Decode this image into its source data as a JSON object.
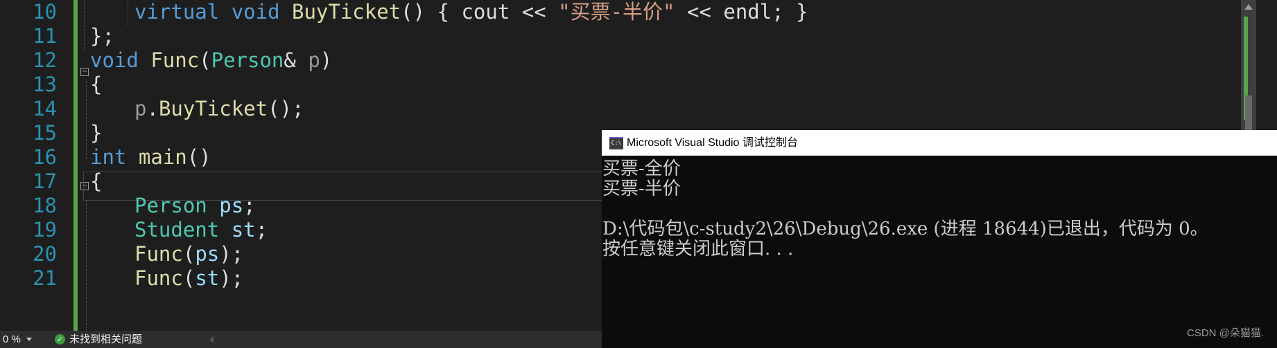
{
  "editor": {
    "line_numbers": [
      "10",
      "11",
      "12",
      "13",
      "14",
      "15",
      "16",
      "17",
      "18",
      "19",
      "20",
      "21"
    ],
    "lines": [
      {
        "segments": [
          [
            "kw",
            "virtual"
          ],
          [
            "",
            " "
          ],
          [
            "kw",
            "void"
          ],
          [
            "",
            " "
          ],
          [
            "fn",
            "BuyTicket"
          ],
          [
            "",
            "() { cout << "
          ],
          [
            "str",
            "\"买票-半价\""
          ],
          [
            "",
            " << endl; }"
          ]
        ]
      },
      {
        "segments": [
          [
            "",
            "};"
          ]
        ]
      },
      {
        "segments": [
          [
            "kw",
            "void"
          ],
          [
            "",
            " "
          ],
          [
            "fn",
            "Func"
          ],
          [
            "",
            "("
          ],
          [
            "ty",
            "Person"
          ],
          [
            "",
            "& "
          ],
          [
            "prm",
            "p"
          ],
          [
            "",
            ")"
          ]
        ]
      },
      {
        "segments": [
          [
            "",
            "{"
          ]
        ]
      },
      {
        "segments": [
          [
            "prm",
            "p"
          ],
          [
            "",
            "."
          ],
          [
            "fn",
            "BuyTicket"
          ],
          [
            "",
            "();"
          ]
        ]
      },
      {
        "segments": [
          [
            "",
            "}"
          ]
        ]
      },
      {
        "segments": [
          [
            "kw",
            "int"
          ],
          [
            "",
            " "
          ],
          [
            "fn",
            "main"
          ],
          [
            "",
            "()"
          ]
        ]
      },
      {
        "segments": [
          [
            "",
            "{"
          ]
        ]
      },
      {
        "segments": [
          [
            "ty",
            "Person"
          ],
          [
            "",
            " "
          ],
          [
            "var",
            "ps"
          ],
          [
            "",
            ";"
          ]
        ]
      },
      {
        "segments": [
          [
            "ty",
            "Student"
          ],
          [
            "",
            " "
          ],
          [
            "var",
            "st"
          ],
          [
            "",
            ";"
          ]
        ]
      },
      {
        "segments": [
          [
            "fn",
            "Func"
          ],
          [
            "",
            "("
          ],
          [
            "var",
            "ps"
          ],
          [
            "",
            ");"
          ]
        ]
      },
      {
        "segments": [
          [
            "fn",
            "Func"
          ],
          [
            "",
            "("
          ],
          [
            "var",
            "st"
          ],
          [
            "",
            ");"
          ]
        ]
      }
    ]
  },
  "statusbar": {
    "zoom": "0 %",
    "issues": "未找到相关问题"
  },
  "console": {
    "title": "Microsoft Visual Studio 调试控制台",
    "icon_text": "C:\\",
    "output": [
      "买票-全价",
      "买票-半价",
      "",
      "D:\\代码包\\c-study2\\26\\Debug\\26.exe (进程 18644)已退出，代码为 0。",
      "按任意键关闭此窗口. . ."
    ],
    "watermark": "CSDN @朵猫猫."
  },
  "colors": {
    "background": "#1e1e1e",
    "keyword": "#569cd6",
    "type": "#4ec9b0",
    "function": "#dcdcaa",
    "string": "#d69d85",
    "line_number": "#2b91af",
    "change_bar": "#57a64a"
  },
  "icons": [
    "fold-minus-icon",
    "check-circle-icon",
    "console-app-icon",
    "scroll-up-icon",
    "dropdown-arrow-icon"
  ]
}
